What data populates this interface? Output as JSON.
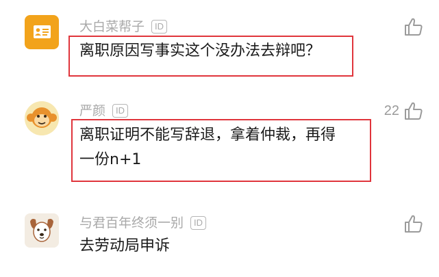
{
  "comments": [
    {
      "username": "大白菜帮子",
      "id_badge": "ID",
      "text_lines": [
        "离职原因写事实这个没办法去辩吧？"
      ],
      "likes": ""
    },
    {
      "username": "严颜",
      "id_badge": "ID",
      "text_lines": [
        "离职证明不能写辞退，拿着仲裁，再得",
        "一份n+1"
      ],
      "likes": "22"
    },
    {
      "username": "与君百年终须一别",
      "id_badge": "ID",
      "text_lines": [
        "去劳动局申诉"
      ],
      "likes": ""
    }
  ],
  "colors": {
    "highlight_border": "#e0343b",
    "username": "#a9a9a9",
    "avatar1_bg": "#f2a31b"
  }
}
